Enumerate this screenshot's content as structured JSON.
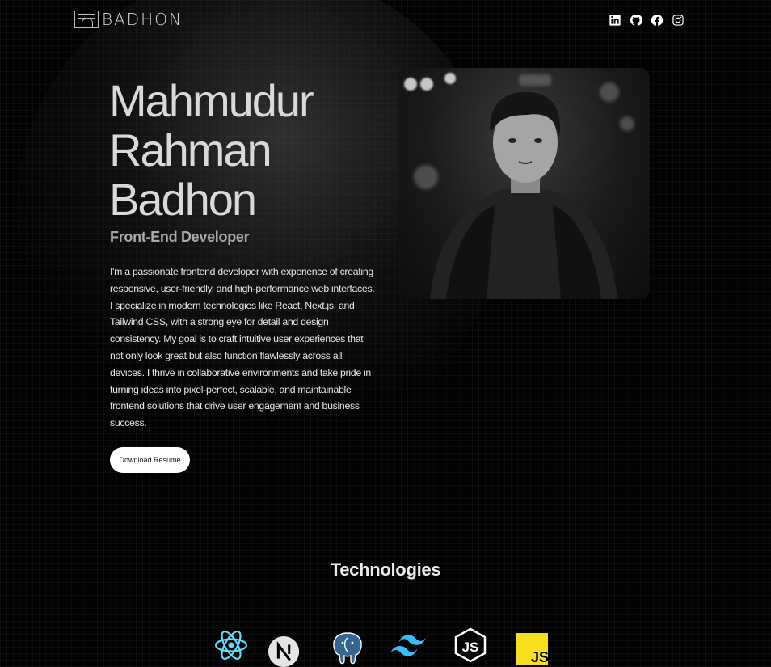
{
  "nav": {
    "logo_text": "BADHON",
    "socials": [
      {
        "name": "linkedin",
        "icon": "linkedin-icon"
      },
      {
        "name": "github",
        "icon": "github-icon"
      },
      {
        "name": "facebook",
        "icon": "facebook-icon"
      },
      {
        "name": "instagram",
        "icon": "instagram-icon"
      }
    ]
  },
  "hero": {
    "name_line1": "Mahmudur",
    "name_line2": "Rahman",
    "name_line3": "Badhon",
    "subtitle": "Front-End Developer",
    "bio": "I'm a passionate frontend developer with experience of creating responsive, user-friendly, and high-performance web interfaces. I specialize in modern technologies like React, Next.js, and Tailwind CSS, with a strong eye for detail and design consistency. My goal is to craft intuitive user experiences that not only look great but also function flawlessly across all devices. I thrive in collaborative environments and take pride in turning ideas into pixel-perfect, scalable, and maintainable frontend solutions that drive user engagement and business success.",
    "resume_label": "Download Resume",
    "photo": "portrait-photo"
  },
  "technologies": {
    "title": "Technologies",
    "items": [
      {
        "name": "react",
        "icon": "react-icon",
        "color": "#61DAFB"
      },
      {
        "name": "nextjs",
        "icon": "nextjs-icon",
        "color": "#E5E5E5"
      },
      {
        "name": "postgresql",
        "icon": "postgresql-icon",
        "color": "#336791"
      },
      {
        "name": "tailwind",
        "icon": "tailwind-icon",
        "color": "#38BDF8"
      },
      {
        "name": "nodejs",
        "icon": "nodejs-icon",
        "color": "#FFFFFF"
      },
      {
        "name": "javascript",
        "icon": "javascript-icon",
        "color": "#F7DF1E"
      }
    ]
  }
}
